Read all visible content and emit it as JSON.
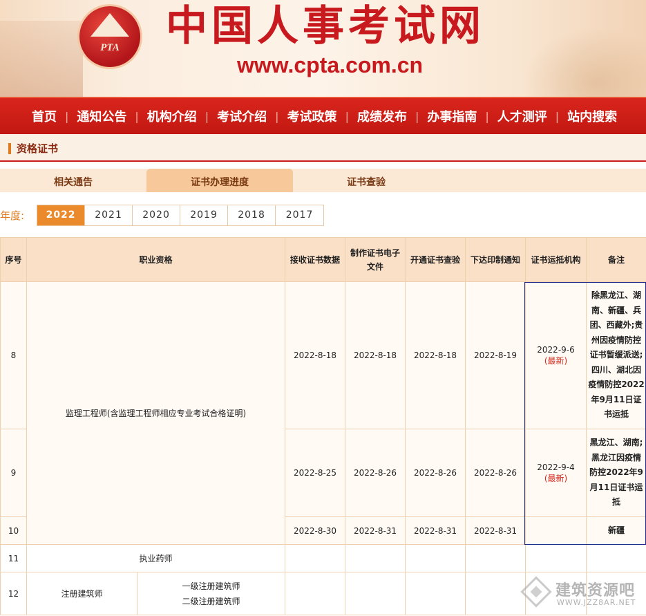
{
  "banner": {
    "logo_text": "PTA",
    "site_title": "中国人事考试网",
    "site_url": "www.cpta.com.cn"
  },
  "nav": {
    "items": [
      {
        "label": "首页"
      },
      {
        "label": "通知公告"
      },
      {
        "label": "机构介绍"
      },
      {
        "label": "考试介绍"
      },
      {
        "label": "考试政策"
      },
      {
        "label": "成绩发布"
      },
      {
        "label": "办事指南"
      },
      {
        "label": "人才测评"
      },
      {
        "label": "站内搜索"
      }
    ],
    "separator": "|"
  },
  "section": {
    "title": "资格证书"
  },
  "tabs": [
    {
      "label": "相关通告",
      "active": false
    },
    {
      "label": "证书办理进度",
      "active": true
    },
    {
      "label": "证书查验",
      "active": false
    }
  ],
  "year_filter": {
    "label": "年度:",
    "years": [
      "2022",
      "2021",
      "2020",
      "2019",
      "2018",
      "2017"
    ],
    "selected": "2022"
  },
  "table": {
    "headers": {
      "seq": "序号",
      "qualification": "职业资格",
      "receive": "接收证书数据",
      "make": "制作证书电子文件",
      "verify": "开通证书查验",
      "print": "下达印制通知",
      "ship": "证书运抵机构",
      "note": "备注"
    },
    "rows": [
      {
        "seq": "8",
        "receive": "2022-8-18",
        "make": "2022-8-18",
        "verify": "2022-8-18",
        "print": "2022-8-19",
        "ship_date": "2022-9-6",
        "ship_tag": "(最新)",
        "note": "除黑龙江、湖南、新疆、兵团、西藏外;贵州因疫情防控证书暂缓派送; 四川、湖北因疫情防控2022年9月11日证书运抵"
      },
      {
        "seq": "9",
        "receive": "2022-8-25",
        "make": "2022-8-26",
        "verify": "2022-8-26",
        "print": "2022-8-26",
        "ship_date": "2022-9-4",
        "ship_tag": "(最新)",
        "note": "黑龙江、湖南; 黑龙江因疫情防控2022年9月11日证书运抵"
      },
      {
        "seq": "10",
        "receive": "2022-8-30",
        "make": "2022-8-31",
        "verify": "2022-8-31",
        "print": "2022-8-31",
        "ship_date": "",
        "ship_tag": "",
        "note": "新疆"
      },
      {
        "seq": "11",
        "qualification": "执业药师"
      },
      {
        "seq": "12",
        "qualification": "注册建筑师",
        "sub_1": "一级注册建筑师",
        "sub_2": "二级注册建筑师"
      }
    ],
    "group_qualification": "监理工程师(含监理工程师相应专业考试合格证明)"
  },
  "watermark": {
    "cn": "建筑资源吧",
    "en": "WWW.JZZ8AR.NET"
  },
  "colors": {
    "brand_red": "#c8191e",
    "nav_red": "#d9251c",
    "accent_orange": "#ea8a2a",
    "highlight_border": "#1e2a8a",
    "newest_red": "#d5281c"
  }
}
